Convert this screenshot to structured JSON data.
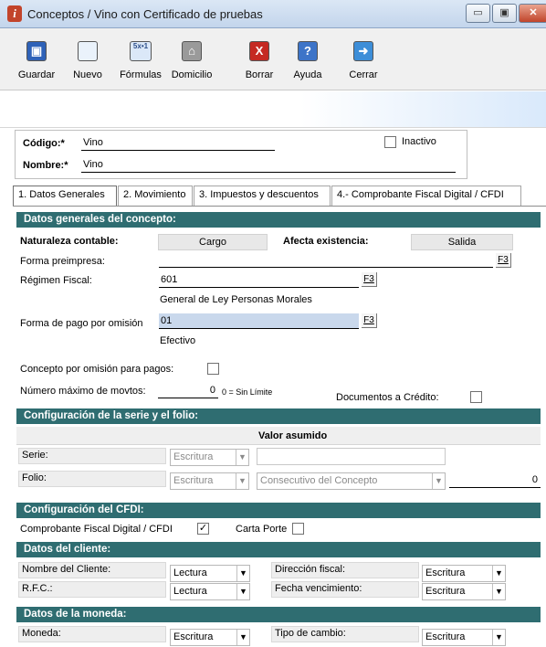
{
  "window": {
    "title": "Conceptos / Vino con Certificado de pruebas",
    "icon": "info-icon",
    "min": "▭",
    "max": "▣",
    "close": "✕"
  },
  "toolbar": [
    {
      "name": "guardar",
      "label": "Guardar",
      "icon": "save-icon",
      "glyph": "▣",
      "color": "#2f62b8"
    },
    {
      "name": "nuevo",
      "label": "Nuevo",
      "icon": "new-document-icon",
      "glyph": "",
      "color": "#eaf2fb"
    },
    {
      "name": "formulas",
      "label": "Fórmulas",
      "icon": "formula-icon",
      "glyph": "5x•1",
      "color": "#dbe8f8"
    },
    {
      "name": "domicilio",
      "label": "Domicilio",
      "icon": "address-icon",
      "glyph": "⌂",
      "color": "#9a9a9a"
    },
    {
      "name": "borrar",
      "label": "Borrar",
      "icon": "delete-icon",
      "glyph": "X",
      "color": "#c52a23"
    },
    {
      "name": "ayuda",
      "label": "Ayuda",
      "icon": "help-icon",
      "glyph": "?",
      "color": "#3d74c8"
    },
    {
      "name": "cerrar",
      "label": "Cerrar",
      "icon": "exit-icon",
      "glyph": "➜",
      "color": "#3d8ed8"
    }
  ],
  "header": {
    "codigo_label": "Código:*",
    "codigo_value": "Vino",
    "nombre_label": "Nombre:*",
    "nombre_value": "Vino",
    "inactivo_label": "Inactivo"
  },
  "tabs": [
    "1. Datos Generales",
    "2. Movimiento",
    "3. Impuestos y descuentos",
    "4.- Comprobante Fiscal Digital / CFDI"
  ],
  "general": {
    "section": "Datos generales del concepto:",
    "naturaleza_label": "Naturaleza contable:",
    "naturaleza_value": "Cargo",
    "afecta_label": "Afecta existencia:",
    "afecta_value": "Salida",
    "forma_preimpresa_label": "Forma preimpresa:",
    "regimen_label": "Régimen Fiscal:",
    "regimen_value": "601",
    "regimen_desc": "General de Ley Personas Morales",
    "forma_pago_label": "Forma de pago por omisión",
    "forma_pago_value": "01",
    "forma_pago_desc": "Efectivo",
    "f3": "F3",
    "concepto_omision_label": "Concepto por omisión para pagos:",
    "num_max_label": "Número máximo de movtos:",
    "num_max_value": "0",
    "num_max_hint": "0 = Sin Límite",
    "docs_credito_label": "Documentos a Crédito:"
  },
  "serie": {
    "section": "Configuración de la serie y el folio:",
    "valor_header": "Valor asumido",
    "serie_label": "Serie:",
    "serie_mode": "Escritura",
    "folio_label": "Folio:",
    "folio_mode": "Escritura",
    "folio_source": "Consecutivo del Concepto",
    "folio_value": "0"
  },
  "cfdi": {
    "section": "Configuración del CFDI:",
    "cfdi_label": "Comprobante Fiscal Digital / CFDI",
    "cfdi_checked": "✓",
    "carta_label": "Carta Porte"
  },
  "cliente": {
    "section": "Datos del cliente:",
    "nombre_label": "Nombre del Cliente:",
    "nombre_mode": "Lectura",
    "dir_label": "Dirección fiscal:",
    "dir_mode": "Escritura",
    "rfc_label": "R.F.C.:",
    "rfc_mode": "Lectura",
    "fecha_label": "Fecha vencimiento:",
    "fecha_mode": "Escritura"
  },
  "moneda": {
    "section": "Datos de la moneda:",
    "moneda_label": "Moneda:",
    "moneda_mode": "Escritura",
    "tipo_label": "Tipo de cambio:",
    "tipo_mode": "Escritura"
  },
  "arrow": "▼"
}
